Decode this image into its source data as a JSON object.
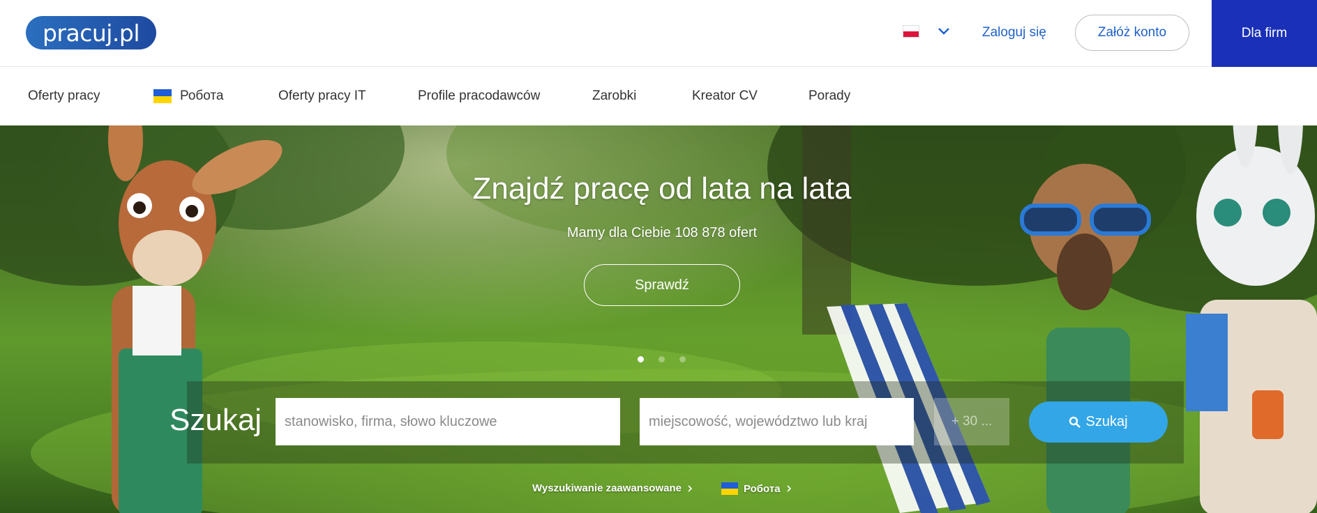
{
  "header": {
    "logo_text": "pracuj.pl",
    "language_flag": "flag-poland",
    "login_label": "Zaloguj się",
    "register_label": "Załóż konto",
    "for_companies_label": "Dla firm",
    "colors": {
      "brand_blue": "#1f61c9",
      "for_companies_bg": "#1a30b8"
    }
  },
  "nav": {
    "items": [
      {
        "label": "Oferty pracy"
      },
      {
        "label": "Робота",
        "icon": "flag-ukraine"
      },
      {
        "label": "Oferty pracy IT"
      },
      {
        "label": "Profile pracodawców"
      },
      {
        "label": "Zarobki"
      },
      {
        "label": "Kreator CV"
      },
      {
        "label": "Porady"
      }
    ]
  },
  "hero": {
    "headline": "Znajdź pracę od lata na lata",
    "subline": "Mamy dla Ciebie 108 878 ofert",
    "cta_label": "Sprawdź",
    "slides": {
      "count": 3,
      "active": 1
    }
  },
  "search": {
    "label": "Szukaj",
    "keyword_placeholder": "stanowisko, firma, słowo kluczowe",
    "location_placeholder": "miejscowość, województwo lub kraj",
    "radius_value": "+ 30 ...",
    "button_label": "Szukaj",
    "button_icon": "search-icon",
    "advanced_label": "Wyszukiwanie zaawansowane",
    "ukraine_label": "Робота",
    "colors": {
      "search_button": "#33a6e8"
    }
  }
}
